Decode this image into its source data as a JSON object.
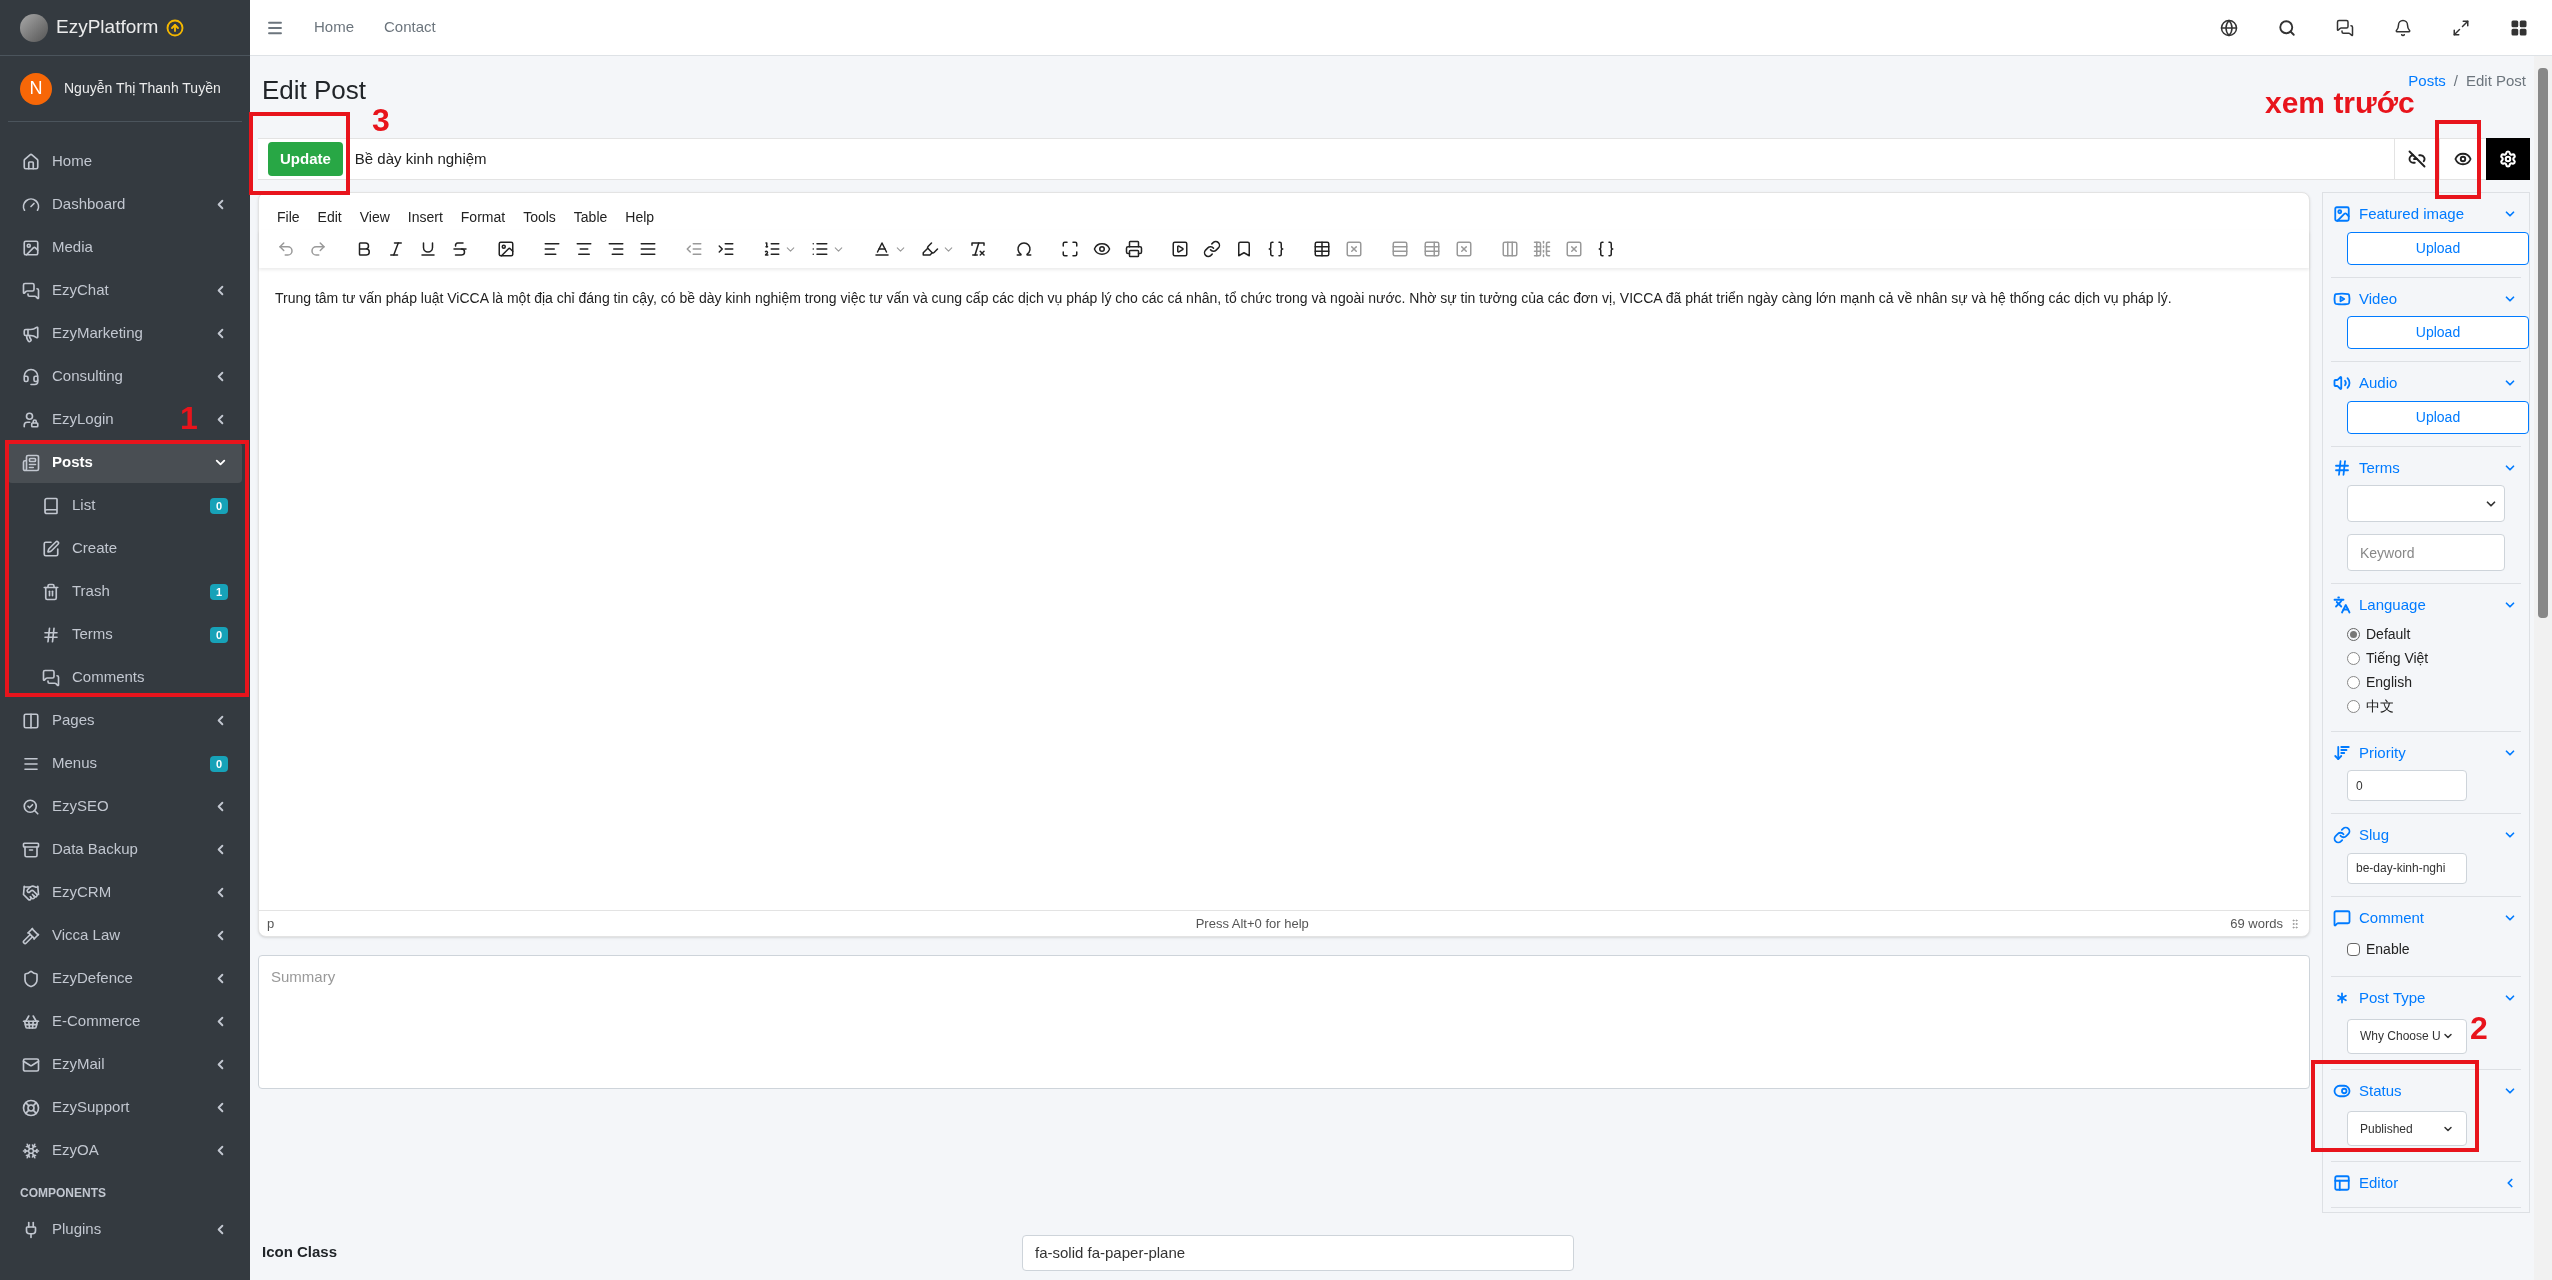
{
  "brand": {
    "name": "EzyPlatform"
  },
  "user": {
    "initial": "N",
    "name": "Nguyễn Thị Thanh Tuyền"
  },
  "sidebar": {
    "items": [
      {
        "kind": "link",
        "label": "Home"
      },
      {
        "kind": "group",
        "label": "Dashboard",
        "expanded": false,
        "selected": false
      },
      {
        "kind": "link",
        "label": "Media"
      },
      {
        "kind": "group",
        "label": "EzyChat",
        "expanded": false,
        "selected": false
      },
      {
        "kind": "group",
        "label": "EzyMarketing",
        "expanded": false,
        "selected": false
      },
      {
        "kind": "group",
        "label": "Consulting",
        "expanded": false,
        "selected": false
      },
      {
        "kind": "group",
        "label": "EzyLogin",
        "expanded": false,
        "selected": false
      },
      {
        "kind": "group",
        "label": "Posts",
        "expanded": true,
        "selected": true,
        "children": [
          {
            "label": "List",
            "badge": "0"
          },
          {
            "label": "Create"
          },
          {
            "label": "Trash",
            "badge": "1"
          },
          {
            "label": "Terms",
            "badge": "0"
          },
          {
            "label": "Comments"
          }
        ]
      },
      {
        "kind": "group",
        "label": "Pages",
        "expanded": false,
        "selected": false
      },
      {
        "kind": "link",
        "label": "Menus",
        "badge": "0"
      },
      {
        "kind": "group",
        "label": "EzySEO",
        "expanded": false,
        "selected": false
      },
      {
        "kind": "group",
        "label": "Data Backup",
        "expanded": false,
        "selected": false
      },
      {
        "kind": "group",
        "label": "EzyCRM",
        "expanded": false,
        "selected": false
      },
      {
        "kind": "group",
        "label": "Vicca Law",
        "expanded": false,
        "selected": false
      },
      {
        "kind": "group",
        "label": "EzyDefence",
        "expanded": false,
        "selected": false
      },
      {
        "kind": "group",
        "label": "E-Commerce",
        "expanded": false,
        "selected": false
      },
      {
        "kind": "group",
        "label": "EzyMail",
        "expanded": false,
        "selected": false
      },
      {
        "kind": "group",
        "label": "EzySupport",
        "expanded": false,
        "selected": false
      },
      {
        "kind": "group",
        "label": "EzyOA",
        "expanded": false,
        "selected": false
      },
      {
        "kind": "header",
        "label": "COMPONENTS"
      },
      {
        "kind": "group",
        "label": "Plugins",
        "expanded": false,
        "selected": false
      }
    ]
  },
  "topbar": {
    "links": [
      "Home",
      "Contact"
    ]
  },
  "page": {
    "title": "Edit Post",
    "breadcrumb": [
      {
        "label": "Posts",
        "kind": "link"
      },
      {
        "label": "Edit Post",
        "kind": "current"
      }
    ],
    "separator": "/"
  },
  "post": {
    "update_button": "Update",
    "title": "Bề dày kinh nghiệm"
  },
  "editor": {
    "menus": [
      "File",
      "Edit",
      "View",
      "Insert",
      "Format",
      "Tools",
      "Table",
      "Help"
    ],
    "content": "Trung tâm tư vấn pháp luật ViCCA là một địa chỉ đáng tin cậy, có bề dày kinh nghiệm trong việc tư vấn và cung cấp các dịch vụ pháp lý cho các cá nhân, tổ chức trong và ngoài nước. Nhờ sự tin tưởng của các đơn vị, VICCA đã phát triển ngày càng lớn mạnh cả về nhân sự và hệ thống các dịch vụ pháp lý.",
    "status_path": "p",
    "help": "Press Alt+0 for help",
    "word_count": "69 words"
  },
  "summary": {
    "placeholder": "Summary"
  },
  "icon_class": {
    "label": "Icon Class",
    "value": "fa-solid fa-paper-plane"
  },
  "panel": {
    "sections": [
      {
        "kind": "upload",
        "title": "Featured image",
        "expanded": true,
        "button": "Upload"
      },
      {
        "kind": "upload",
        "title": "Video",
        "expanded": true,
        "button": "Upload"
      },
      {
        "kind": "upload",
        "title": "Audio",
        "expanded": true,
        "button": "Upload"
      },
      {
        "kind": "terms",
        "title": "Terms",
        "expanded": true,
        "placeholder": "Keyword"
      },
      {
        "kind": "radios",
        "title": "Language",
        "expanded": true,
        "options": [
          {
            "label": "Default",
            "selected": true
          },
          {
            "label": "Tiếng Việt",
            "selected": false
          },
          {
            "label": "English",
            "selected": false
          },
          {
            "label": "中文",
            "selected": false
          }
        ]
      },
      {
        "kind": "input",
        "title": "Priority",
        "expanded": true,
        "value": "0"
      },
      {
        "kind": "input",
        "title": "Slug",
        "expanded": true,
        "value": "be-day-kinh-nghi"
      },
      {
        "kind": "checkbox",
        "title": "Comment",
        "expanded": true,
        "label": "Enable",
        "checked": false
      },
      {
        "kind": "select",
        "title": "Post Type",
        "expanded": true,
        "value": "Why Choose U"
      },
      {
        "kind": "select",
        "title": "Status",
        "expanded": true,
        "value": "Published"
      },
      {
        "kind": "empty",
        "title": "Editor",
        "expanded": false
      }
    ]
  },
  "annotations": [
    {
      "label": "1"
    },
    {
      "label": "2"
    },
    {
      "label": "3"
    },
    {
      "label": "xem trước"
    }
  ]
}
